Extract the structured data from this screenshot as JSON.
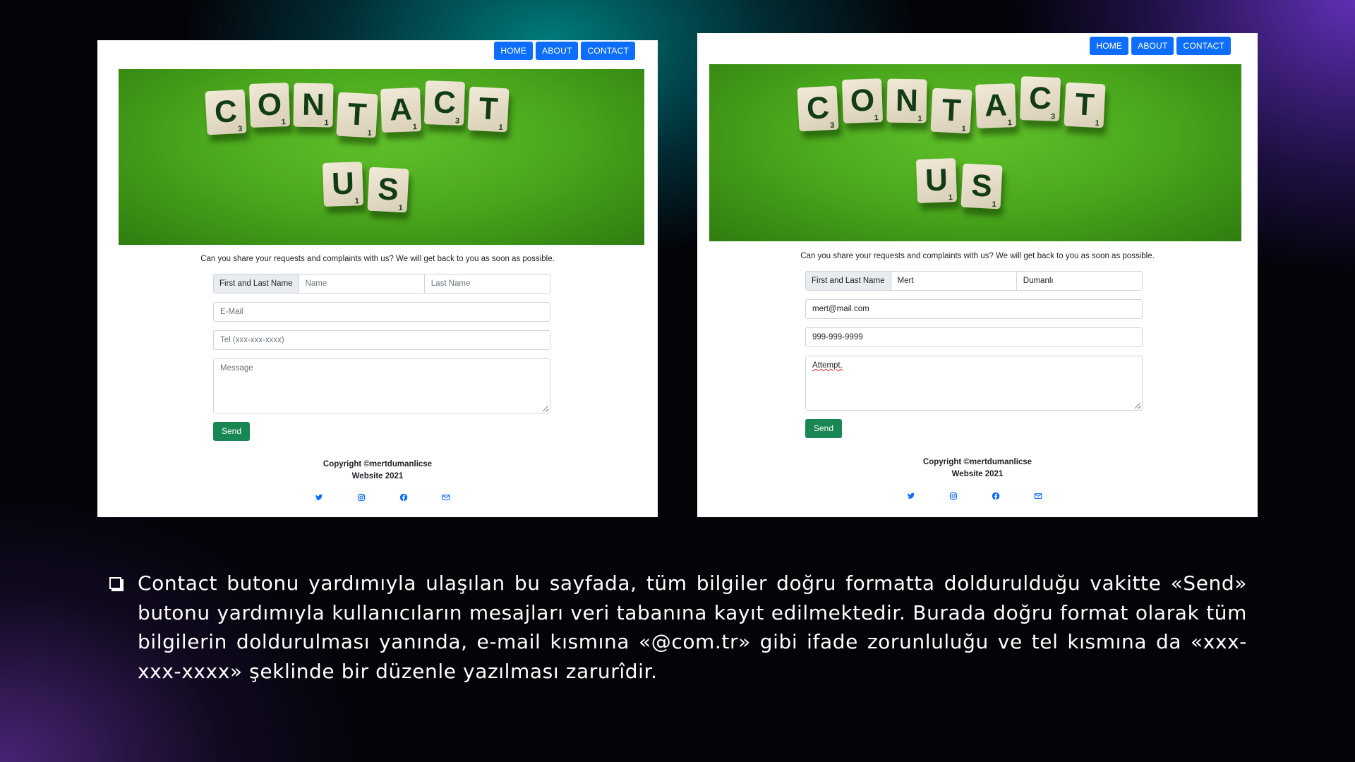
{
  "left_screenshot": {
    "nav": {
      "home": "HOME",
      "about": "ABOUT",
      "contact": "CONTACT"
    },
    "hero_letters": {
      "row1": [
        {
          "l": "C",
          "n": "3"
        },
        {
          "l": "O",
          "n": "1"
        },
        {
          "l": "N",
          "n": "1"
        },
        {
          "l": "T",
          "n": "1"
        },
        {
          "l": "A",
          "n": "1"
        },
        {
          "l": "C",
          "n": "3"
        },
        {
          "l": "T",
          "n": "1"
        }
      ],
      "row2": [
        {
          "l": "U",
          "n": "1"
        },
        {
          "l": "S",
          "n": "1"
        }
      ]
    },
    "intro": "Can you share your requests and complaints with us? We will get back to you as soon as possible.",
    "form": {
      "name_label": "First and Last Name",
      "first_name_placeholder": "Name",
      "last_name_placeholder": "Last Name",
      "email_placeholder": "E-Mail",
      "tel_placeholder": "Tel (xxx-xxx-xxxx)",
      "message_placeholder": "Message",
      "send": "Send"
    },
    "footer": {
      "copyright": "Copyright ©mertdumanlicse",
      "website": "Website 2021"
    },
    "socials": [
      "twitter-icon",
      "instagram-icon",
      "facebook-icon",
      "mail-icon"
    ]
  },
  "right_screenshot": {
    "nav": {
      "home": "HOME",
      "about": "ABOUT",
      "contact": "CONTACT"
    },
    "intro": "Can you share your requests and complaints with us? We will get back to you as soon as possible.",
    "form": {
      "name_label": "First and Last Name",
      "first_name_value": "Mert",
      "last_name_value": "Dumanlı",
      "email_value": "mert@mail.com",
      "tel_value": "999-999-9999",
      "message_value": "Attempt.",
      "send": "Send"
    },
    "footer": {
      "copyright": "Copyright ©mertdumanlicse",
      "website": "Website 2021"
    },
    "socials": [
      "twitter-icon",
      "instagram-icon",
      "facebook-icon",
      "mail-icon"
    ]
  },
  "caption": "Contact butonu yardımıyla ulaşılan bu sayfada, tüm bilgiler doğru formatta doldurulduğu vakitte «Send» butonu yardımıyla kullanıcıların mesajları veri tabanına kayıt edilmektedir. Burada doğru format olarak tüm bilgilerin doldurulması yanında, e-mail kısmına «@com.tr» gibi ifade zorunluluğu ve tel kısmına da «xxx-xxx-xxxx» şeklinde bir düzenle yazılması zarurîdir.",
  "colors": {
    "nav_button": "#0d6efd",
    "send_button": "#198754",
    "hero_green": "#4aa71c",
    "social_icon": "#0d6efd"
  }
}
